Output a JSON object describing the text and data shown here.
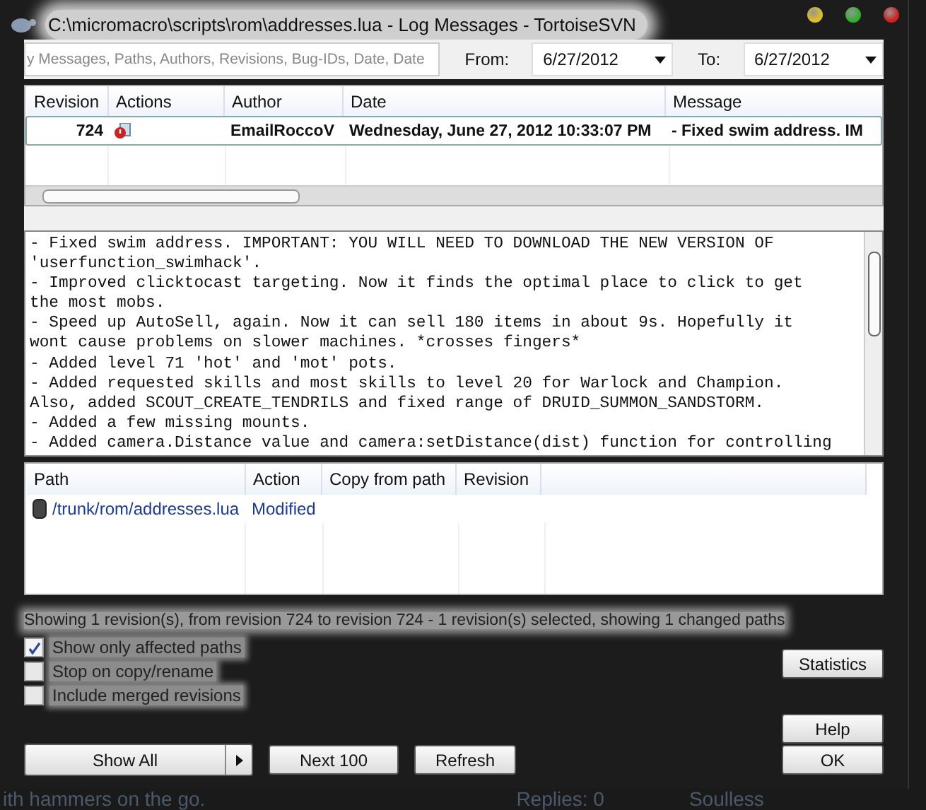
{
  "window": {
    "title": "C:\\micromacro\\scripts\\rom\\addresses.lua - Log Messages - TortoiseSVN"
  },
  "filter": {
    "placeholder": "y Messages, Paths, Authors, Revisions, Bug-IDs, Date, Date",
    "from_label": "From:",
    "from_value": "6/27/2012",
    "to_label": "To:",
    "to_value": "6/27/2012"
  },
  "log": {
    "columns": [
      "Revision",
      "Actions",
      "Author",
      "Date",
      "Message"
    ],
    "rows": [
      {
        "revision": "724",
        "author": "EmailRoccoV",
        "date": "Wednesday, June 27, 2012 10:33:07 PM",
        "message": "- Fixed swim address. IM",
        "selected": true
      }
    ]
  },
  "message_lines": [
    "- Fixed swim address. IMPORTANT: YOU WILL NEED TO DOWNLOAD THE NEW VERSION OF",
    "'userfunction_swimhack'.",
    "- Improved clicktocast targeting. Now it finds the optimal place to click to get",
    "the most mobs.",
    "- Speed up AutoSell, again. Now it can sell 180 items in about 9s. Hopefully it",
    "wont cause problems on slower machines. *crosses fingers*",
    "- Added level 71 'hot' and 'mot' pots.",
    "- Added requested skills and most skills to level 20 for Warlock and Champion.",
    "Also, added SCOUT_CREATE_TENDRILS and fixed range of DRUID_SUMMON_SANDSTORM.",
    "- Added a few missing mounts.",
    "- Added camera.Distance value and camera:setDistance(dist) function for controlling"
  ],
  "paths": {
    "columns": [
      "Path",
      "Action",
      "Copy from path",
      "Revision"
    ],
    "rows": [
      {
        "path": "/trunk/rom/addresses.lua",
        "action": "Modified"
      }
    ]
  },
  "status": "Showing 1 revision(s), from revision 724 to revision 724 - 1 revision(s) selected, showing 1 changed paths",
  "options": [
    {
      "label": "Show only affected paths",
      "checked": true
    },
    {
      "label": "Stop on copy/rename",
      "checked": false
    },
    {
      "label": "Include merged revisions",
      "checked": false
    }
  ],
  "buttons": {
    "show_all": "Show All",
    "next": "Next 100",
    "refresh": "Refresh",
    "statistics": "Statistics",
    "help": "Help",
    "ok": "OK"
  },
  "background": {
    "text": "ith hammers on the go.",
    "replies": "Replies: 0",
    "user": "Soulless"
  }
}
